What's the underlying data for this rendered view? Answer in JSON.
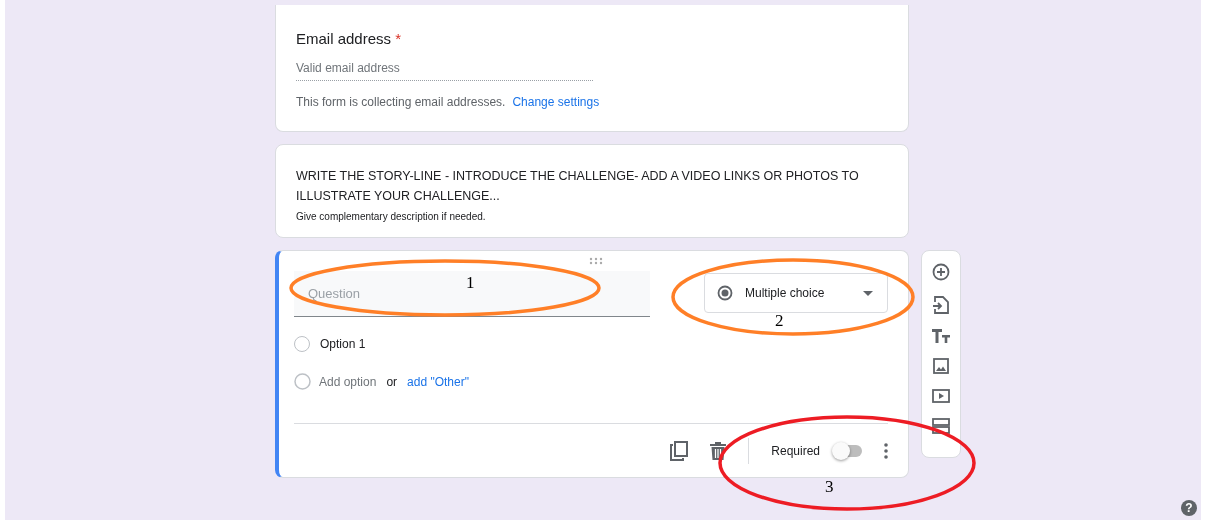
{
  "email_card": {
    "label": "Email address",
    "required_mark": "*",
    "placeholder": "Valid email address",
    "note": "This form is collecting email addresses.",
    "link": "Change settings"
  },
  "section_card": {
    "title": "WRITE THE STORY-LINE - INTRODUCE THE CHALLENGE- ADD A VIDEO LINKS OR PHOTOS TO ILLUSTRATE YOUR CHALLENGE...",
    "description": "Give complementary description if needed."
  },
  "question_card": {
    "placeholder": "Question",
    "type": "Multiple choice",
    "options": [
      {
        "label": "Option 1",
        "selected": false
      }
    ],
    "add_option": "Add option",
    "or": "or",
    "add_other": "add \"Other\"",
    "required": {
      "label": "Required",
      "on": false
    }
  },
  "help": "?",
  "annotations": [
    {
      "label": "1",
      "color": "#ff7f27"
    },
    {
      "label": "2",
      "color": "#ff7f27"
    },
    {
      "label": "3",
      "color": "#ed1c24"
    }
  ]
}
